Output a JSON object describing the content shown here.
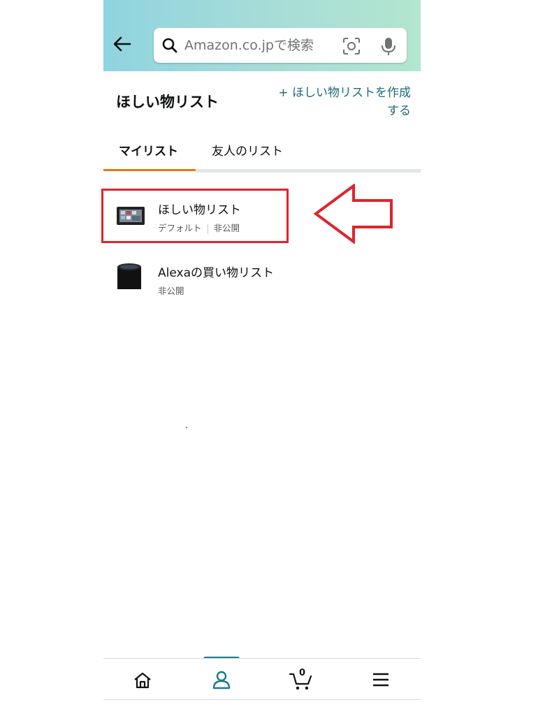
{
  "search": {
    "placeholder": "Amazon.co.jpで検索"
  },
  "page": {
    "title": "ほしい物リスト",
    "create_link": "+ ほしい物リストを作成する"
  },
  "tabs": [
    {
      "label": "マイリスト",
      "active": true
    },
    {
      "label": "友人のリスト",
      "active": false
    }
  ],
  "lists": [
    {
      "name": "ほしい物リスト",
      "meta": [
        "デフォルト",
        "非公開"
      ],
      "thumbnail": "fire-tablet"
    },
    {
      "name": "Alexaの買い物リスト",
      "meta": [
        "非公開"
      ],
      "thumbnail": "echo-speaker"
    }
  ],
  "nav": {
    "items": [
      "home-icon",
      "account-icon",
      "cart-icon",
      "menu-icon"
    ],
    "cart_count": "0",
    "active_index": 1
  },
  "colors": {
    "header_gradient": [
      "#8fd4df",
      "#b2e6cf"
    ],
    "link": "#1d6b78",
    "tab_underline": "#e47911",
    "annotation": "#e0242c",
    "nav_active": "#1d7a8a"
  }
}
